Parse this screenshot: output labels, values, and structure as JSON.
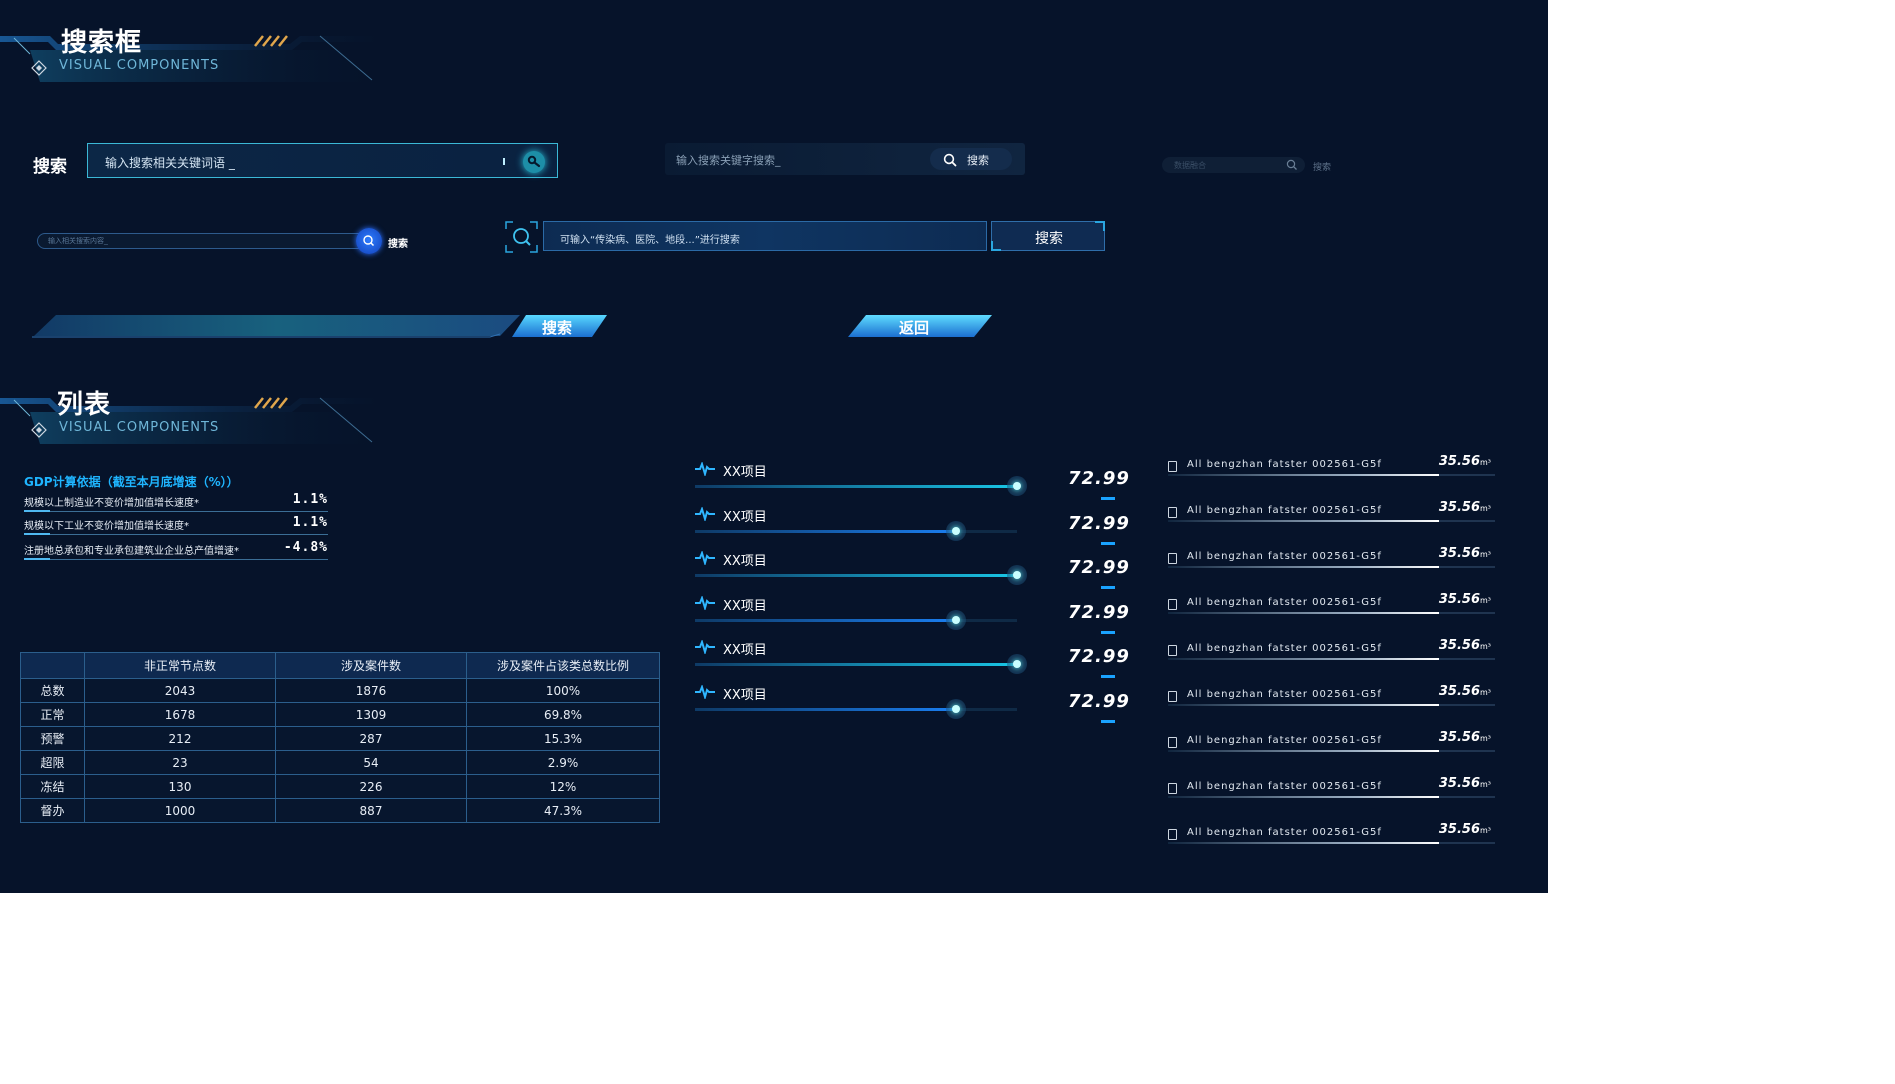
{
  "sections": {
    "search": {
      "title": "搜索框",
      "subtitle": "VISUAL COMPONENTS"
    },
    "list": {
      "title": "列表",
      "subtitle": "VISUAL COMPONENTS"
    }
  },
  "search1": {
    "label": "搜索",
    "placeholder": "输入搜索相关关键词语 _"
  },
  "search2": {
    "placeholder": "输入搜索关键字搜索_",
    "button": "搜索"
  },
  "search3": {
    "placeholder": "数据融合",
    "button": "搜索"
  },
  "search4": {
    "placeholder": "输入相关搜索内容_",
    "button": "搜索"
  },
  "search5": {
    "placeholder": "可输入“传染病、医院、地段...”进行搜索",
    "button": "搜索"
  },
  "buttons": {
    "search_slant": "搜索",
    "back": "返回"
  },
  "gdp": {
    "title": "GDP计算依据（截至本月底增速（%））",
    "rows": [
      {
        "label": "规模以上制造业不变价增加值增长速度*",
        "value": "1.1%"
      },
      {
        "label": "规模以下工业不变价增加值增长速度*",
        "value": "1.1%"
      },
      {
        "label": "注册地总承包和专业承包建筑业企业总产值增速*",
        "value": "-4.8%"
      }
    ]
  },
  "table": {
    "headers": [
      "",
      "非正常节点数",
      "涉及案件数",
      "涉及案件占该类总数比例"
    ],
    "rows": [
      [
        "总数",
        "2043",
        "1876",
        "100%"
      ],
      [
        "正常",
        "1678",
        "1309",
        "69.8%"
      ],
      [
        "预警",
        "212",
        "287",
        "15.3%"
      ],
      [
        "超限",
        "23",
        "54",
        "2.9%"
      ],
      [
        "冻结",
        "130",
        "226",
        "12%"
      ],
      [
        "督办",
        "1000",
        "887",
        "47.3%"
      ]
    ]
  },
  "progress": [
    {
      "name": "XX项目",
      "value": "72.99",
      "level": 1.0,
      "color": "#19c6e6"
    },
    {
      "name": "XX项目",
      "value": "72.99",
      "level": 0.81,
      "color": "#1a7ef0"
    },
    {
      "name": "XX项目",
      "value": "72.99",
      "level": 1.0,
      "color": "#19c6e6"
    },
    {
      "name": "XX项目",
      "value": "72.99",
      "level": 0.81,
      "color": "#1a7ef0"
    },
    {
      "name": "XX项目",
      "value": "72.99",
      "level": 1.0,
      "color": "#19c6e6"
    },
    {
      "name": "XX项目",
      "value": "72.99",
      "level": 0.81,
      "color": "#1a7ef0"
    }
  ],
  "rlist": [
    {
      "text": "All bengzhan fatster 002561-G5f",
      "value": "35.56",
      "unit": "m³",
      "level": 0.83
    },
    {
      "text": "All bengzhan fatster 002561-G5f",
      "value": "35.56",
      "unit": "m³",
      "level": 0.83
    },
    {
      "text": "All bengzhan fatster 002561-G5f",
      "value": "35.56",
      "unit": "m³",
      "level": 0.83
    },
    {
      "text": "All bengzhan fatster 002561-G5f",
      "value": "35.56",
      "unit": "m³",
      "level": 0.83
    },
    {
      "text": "All bengzhan fatster 002561-G5f",
      "value": "35.56",
      "unit": "m³",
      "level": 0.83
    },
    {
      "text": "All bengzhan fatster 002561-G5f",
      "value": "35.56",
      "unit": "m³",
      "level": 0.83
    },
    {
      "text": "All bengzhan fatster 002561-G5f",
      "value": "35.56",
      "unit": "m³",
      "level": 0.83
    },
    {
      "text": "All bengzhan fatster 002561-G5f",
      "value": "35.56",
      "unit": "m³",
      "level": 0.83
    },
    {
      "text": "All bengzhan fatster 002561-G5f",
      "value": "35.56",
      "unit": "m³",
      "level": 0.83
    }
  ],
  "icons": {
    "search": "search-icon",
    "pulse": "pulse-icon",
    "item": "document-icon",
    "diamond": "diamond-icon"
  },
  "colors": {
    "background": "#06132a",
    "accent": "#19c6e6",
    "blue": "#1a7ef0"
  }
}
